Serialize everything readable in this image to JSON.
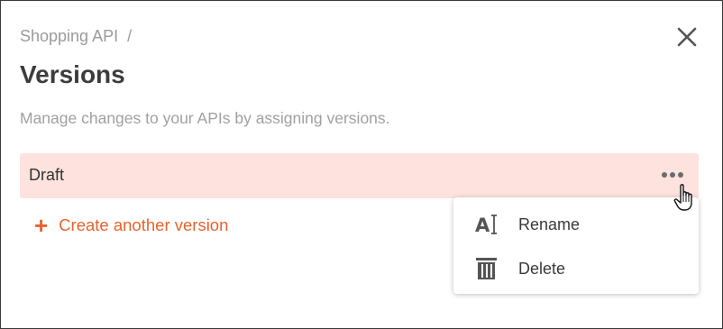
{
  "breadcrumb": {
    "parent": "Shopping API",
    "separator": "/"
  },
  "header": {
    "title": "Versions",
    "subtitle": "Manage changes to your APIs by assigning versions."
  },
  "versions": [
    {
      "name": "Draft"
    }
  ],
  "actions": {
    "create_label": "Create another version",
    "create_icon": "+"
  },
  "context_menu": {
    "items": [
      {
        "label": "Rename",
        "icon": "rename-icon"
      },
      {
        "label": "Delete",
        "icon": "trash-icon"
      }
    ]
  },
  "colors": {
    "accent": "#e8622c",
    "row_highlight": "#fde2dd",
    "muted_text": "#a0a0a0"
  }
}
